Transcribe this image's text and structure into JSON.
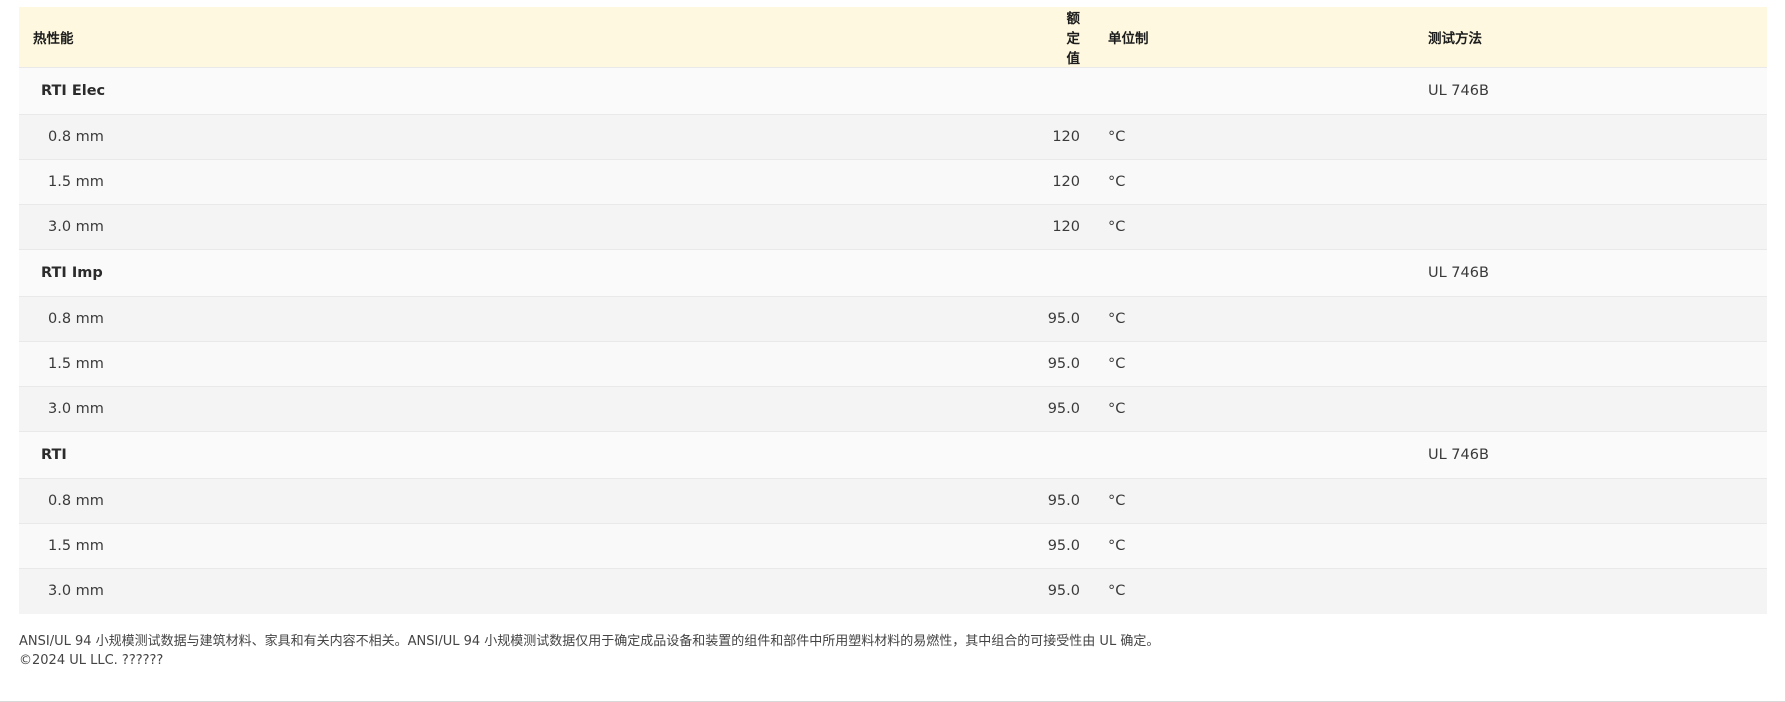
{
  "table": {
    "headers": {
      "property": "热性能",
      "value": "额定值",
      "unit": "单位制",
      "method": "测试方法"
    },
    "groups": [
      {
        "name": "RTI Elec",
        "method": "UL 746B",
        "rows": [
          {
            "thickness": "0.8 mm",
            "value": "120",
            "unit": "°C"
          },
          {
            "thickness": "1.5 mm",
            "value": "120",
            "unit": "°C"
          },
          {
            "thickness": "3.0 mm",
            "value": "120",
            "unit": "°C"
          }
        ]
      },
      {
        "name": "RTI Imp",
        "method": "UL 746B",
        "rows": [
          {
            "thickness": "0.8 mm",
            "value": "95.0",
            "unit": "°C"
          },
          {
            "thickness": "1.5 mm",
            "value": "95.0",
            "unit": "°C"
          },
          {
            "thickness": "3.0 mm",
            "value": "95.0",
            "unit": "°C"
          }
        ]
      },
      {
        "name": "RTI",
        "method": "UL 746B",
        "rows": [
          {
            "thickness": "0.8 mm",
            "value": "95.0",
            "unit": "°C"
          },
          {
            "thickness": "1.5 mm",
            "value": "95.0",
            "unit": "°C"
          },
          {
            "thickness": "3.0 mm",
            "value": "95.0",
            "unit": "°C"
          }
        ]
      }
    ]
  },
  "footer": {
    "disclaimer": "ANSI/UL 94 小规模测试数据与建筑材料、家具和有关内容不相关。ANSI/UL 94 小规模测试数据仅用于确定成品设备和装置的组件和部件中所用塑料材料的易燃性，其中组合的可接受性由 UL 确定。",
    "copyright": "©2024 UL LLC. ??????"
  }
}
